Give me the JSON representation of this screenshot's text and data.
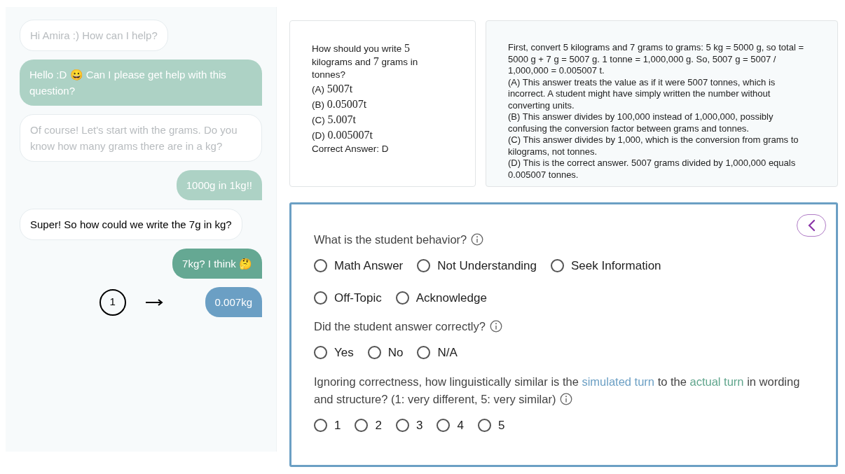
{
  "chat": {
    "messages": [
      {
        "kind": "tutor",
        "faded": true,
        "text": "Hi Amira :) How can I help?"
      },
      {
        "kind": "student",
        "faded": true,
        "text": "Hello :D 😀 Can I please get help with this question?"
      },
      {
        "kind": "tutor",
        "faded": true,
        "text": "Of course! Let's start with the grams. Do you know how many grams there are in a kg?"
      },
      {
        "kind": "student",
        "faded": true,
        "text": "1000g in 1kg!!"
      },
      {
        "kind": "tutor",
        "faded": false,
        "text": "Super! So how could we write the 7g in kg?"
      },
      {
        "kind": "student",
        "faded": false,
        "text": "7kg? I think 🤔"
      },
      {
        "kind": "simulated",
        "text": "0.007kg",
        "marker": "1"
      }
    ]
  },
  "problem": {
    "question": [
      "How should you write ",
      "5",
      "kilograms and ",
      "7",
      " grams in tonnes?"
    ],
    "options": [
      {
        "label": "(A)",
        "value": "5007t"
      },
      {
        "label": "(B)",
        "value": "0.05007t"
      },
      {
        "label": "(C)",
        "value": "5.007t"
      },
      {
        "label": "(D)",
        "value": "0.005007t"
      }
    ],
    "answer": "Correct Answer: D"
  },
  "explanation": [
    "First, convert 5 kilograms and 7 grams to grams: 5 kg = 5000 g, so total = 5000 g + 7 g = 5007 g. 1 tonne = 1,000,000 g. So, 5007 g = 5007 / 1,000,000 = 0.005007 t.",
    "(A) This answer treats the value as if it were 5007 tonnes, which is incorrect. A student might have simply written the number without converting units.",
    "(B) This answer divides by 100,000 instead of 1,000,000, possibly confusing the conversion factor between grams and tonnes.",
    "(C) This answer divides by 1,000, which is the conversion from grams to kilograms, not tonnes.",
    "(D) This is the correct answer. 5007 grams divided by 1,000,000 equals 0.005007 tonnes."
  ],
  "form": {
    "questions": [
      {
        "segments": [
          {
            "text": "What is the student behavior?"
          }
        ],
        "choices": [
          {
            "label": "Math Answer",
            "selected": false
          },
          {
            "label": "Not Understanding",
            "selected": false
          },
          {
            "label": "Seek Information",
            "selected": false
          },
          {
            "label": "Off-Topic",
            "selected": false
          },
          {
            "label": "Acknowledge",
            "selected": false
          }
        ]
      },
      {
        "segments": [
          {
            "text": "Did the student answer correctly?"
          }
        ],
        "choices": [
          {
            "label": "Yes",
            "selected": false
          },
          {
            "label": "No",
            "selected": false
          },
          {
            "label": "N/A",
            "selected": false
          }
        ]
      },
      {
        "segments": [
          {
            "text": "Ignoring correctness, how linguistically similar is the "
          },
          {
            "text": "simulated turn",
            "color": "#6b9fc4"
          },
          {
            "text": " to the "
          },
          {
            "text": "actual turn",
            "color": "#5fa58c"
          },
          {
            "text": " in wording and structure? (1: very different, 5: very similar)"
          }
        ],
        "choices": [
          {
            "label": "1",
            "selected": false
          },
          {
            "label": "2",
            "selected": false
          },
          {
            "label": "3",
            "selected": false
          },
          {
            "label": "4",
            "selected": false
          },
          {
            "label": "5",
            "selected": false
          }
        ]
      }
    ]
  }
}
